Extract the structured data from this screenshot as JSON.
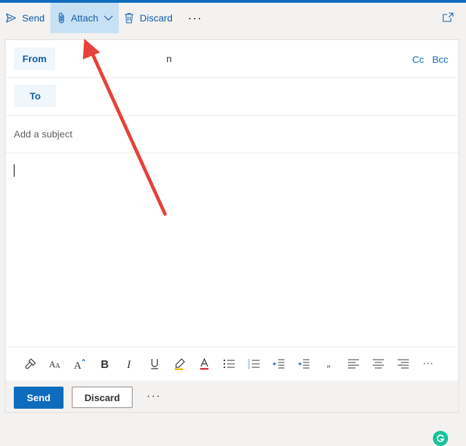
{
  "toolbar": {
    "send_label": "Send",
    "attach_label": "Attach",
    "discard_label": "Discard",
    "more_label": "···"
  },
  "compose": {
    "from_label": "From",
    "from_value": "n",
    "cc_label": "Cc",
    "bcc_label": "Bcc",
    "to_label": "To",
    "subject_placeholder": "Add a subject"
  },
  "format_bar": {
    "tools": [
      "format-painter",
      "font-size",
      "grow-font",
      "bold",
      "italic",
      "underline",
      "highlight",
      "font-color",
      "bullets",
      "numbering",
      "decrease-indent",
      "increase-indent",
      "quote",
      "align-left",
      "align-center",
      "align-right",
      "more"
    ],
    "quote_glyph": "„",
    "more_glyph": "···"
  },
  "actions": {
    "send_label": "Send",
    "discard_label": "Discard",
    "more_label": "···"
  },
  "colors": {
    "accent": "#0f6cbd",
    "attach_highlight": "#c7e0f4",
    "arrow": "#e8403a",
    "grammarly": "#15c39a"
  }
}
